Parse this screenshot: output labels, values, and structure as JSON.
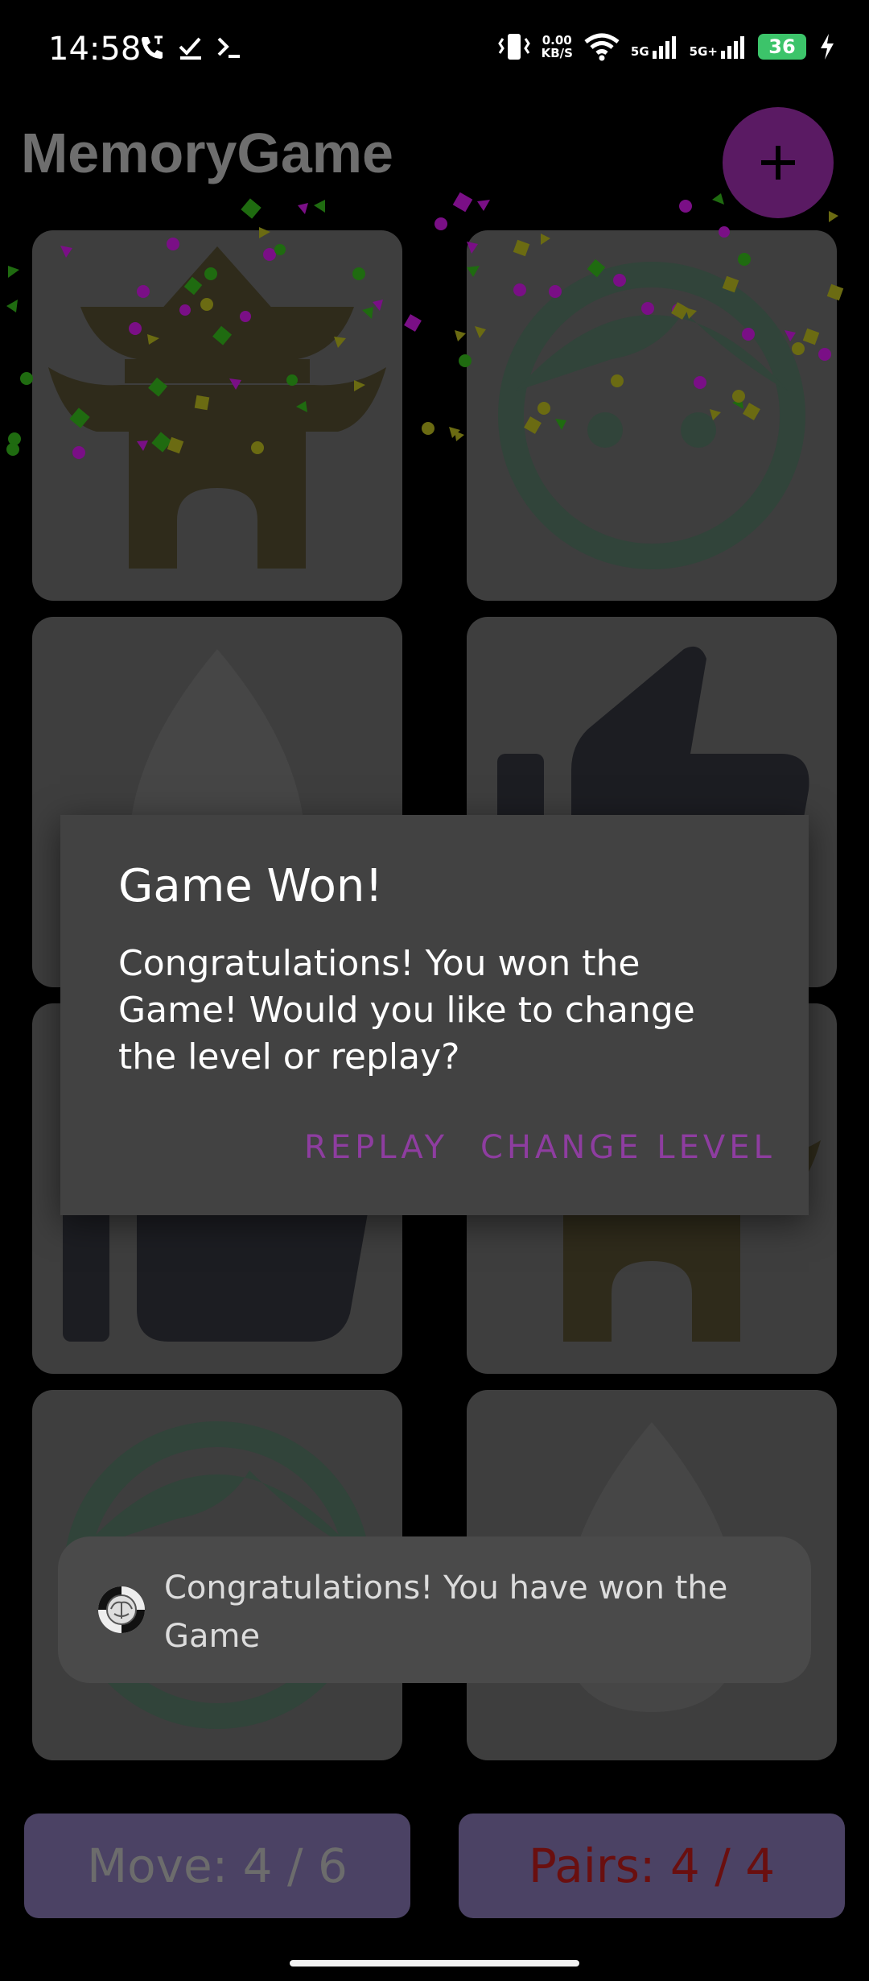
{
  "status_bar": {
    "time": "14:58",
    "speed_value": "0.00",
    "speed_unit": "KB/S",
    "net1": "5G",
    "net2": "5G+",
    "battery": "36"
  },
  "app_bar": {
    "title": "MemoryGame",
    "fab_icon": "plus-icon"
  },
  "cards": [
    {
      "icon": "pagoda-icon",
      "color": "#2f2b1b"
    },
    {
      "icon": "face-icon",
      "color": "#31443a"
    },
    {
      "icon": "drop-icon",
      "color": "#464646"
    },
    {
      "icon": "thumbs-up-icon",
      "color": "#1c1d22"
    },
    {
      "icon": "thumbs-up-icon",
      "color": "#1c1d22"
    },
    {
      "icon": "pagoda-icon",
      "color": "#2f2b1b"
    },
    {
      "icon": "face-icon",
      "color": "#31443a"
    },
    {
      "icon": "drop-icon",
      "color": "#464646"
    }
  ],
  "dialog": {
    "title": "Game Won!",
    "message": "Congratulations! You won the Game! Would you like to change the level or replay?",
    "replay_label": "REPLAY",
    "change_level_label": "CHANGE LEVEL"
  },
  "toast": {
    "text": "Congratulations! You have won the Game",
    "icon": "brain-icon"
  },
  "counters": {
    "moves": "Move: 4 / 6",
    "pairs": "Pairs: 4 / 4"
  },
  "colors": {
    "accent": "#8e3da0",
    "fab": "#5a1a63",
    "counter_bg": "#4b4264",
    "pairs_text": "#6a0f0f"
  }
}
